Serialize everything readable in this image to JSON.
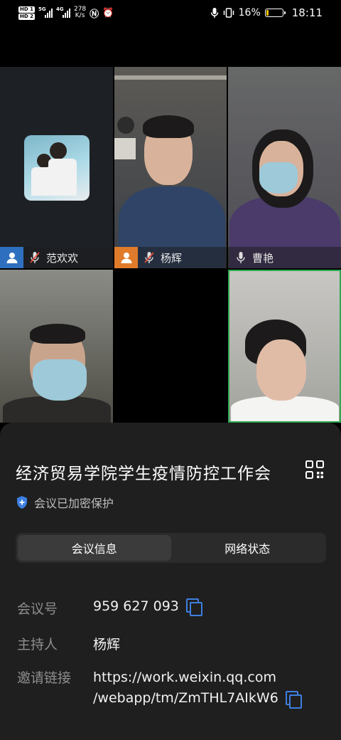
{
  "status_bar": {
    "hd1": "HD 1",
    "hd2": "HD 2",
    "net_tag_1": "5G",
    "net_tag_2": "4G",
    "speed_value": "278",
    "speed_unit": "K/s",
    "nfc_icon": "nfc-icon",
    "alarm_icon": "alarm-icon",
    "battery_percent": "16%",
    "battery_level": 0.16,
    "time": "18:11"
  },
  "participants": [
    {
      "name": "范欢欢",
      "muted": true
    },
    {
      "name": "杨辉",
      "muted": true
    },
    {
      "name": "曹艳",
      "muted": false
    },
    {
      "name": ""
    },
    {
      "name": ""
    },
    {
      "name": ""
    }
  ],
  "sheet": {
    "meeting_title": "经济贸易学院学生疫情防控工作会",
    "encrypted_text": "会议已加密保护",
    "tabs": [
      {
        "label": "会议信息",
        "active": true
      },
      {
        "label": "网络状态",
        "active": false
      }
    ],
    "meeting_id_label": "会议号",
    "meeting_id": "959 627 093",
    "host_label": "主持人",
    "host": "杨辉",
    "invite_label": "邀请链接",
    "invite_line1": "https://work.weixin.qq.com",
    "invite_line2": "/webapp/tm/ZmTHL7AIkW6"
  },
  "colors": {
    "accent_blue": "#3d7fe0",
    "active_speaker_border": "#2fa84f",
    "battery_low": "#f5c400",
    "user_badge_blue": "#2f6fbf",
    "user_badge_orange": "#e07b2c"
  }
}
